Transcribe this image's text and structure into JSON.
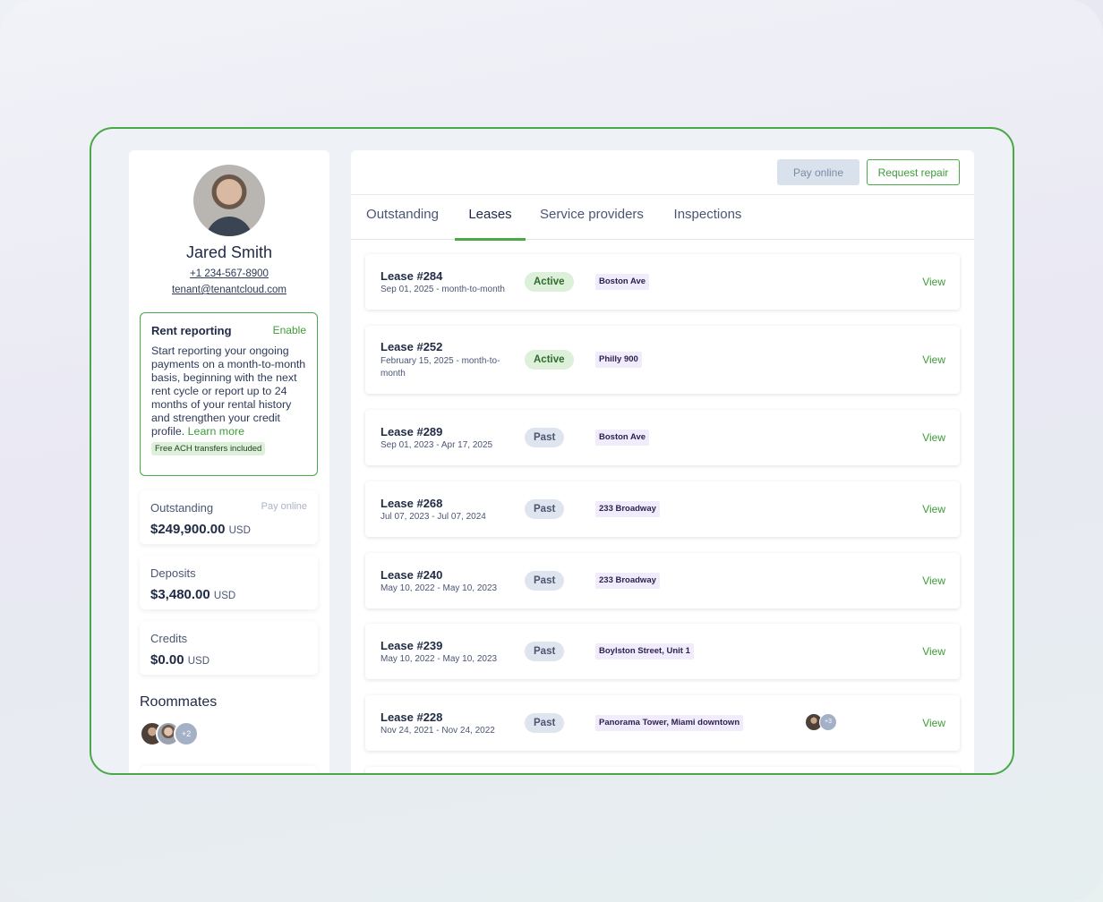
{
  "profile": {
    "name": "Jared Smith",
    "phone": "+1 234-567-8900",
    "email": "tenant@tenantcloud.com"
  },
  "rent_reporting": {
    "title": "Rent reporting",
    "action": "Enable",
    "text": "Start reporting your ongoing payments on a month-to-month basis, beginning with the next rent cycle or report up to 24 months of your rental history and strengthen your credit profile.",
    "learn_more": "Learn more",
    "badge": "Free ACH transfers included"
  },
  "stats": {
    "outstanding": {
      "label": "Outstanding",
      "value": "$249,900.00",
      "unit": "USD",
      "action": "Pay online"
    },
    "deposits": {
      "label": "Deposits",
      "value": "$3,480.00",
      "unit": "USD"
    },
    "credits": {
      "label": "Credits",
      "value": "$0.00",
      "unit": "USD"
    }
  },
  "roommates": {
    "title": "Roommates",
    "extra": "+2"
  },
  "toolbar": {
    "pay_online": "Pay online",
    "request_repair": "Request repair"
  },
  "tabs": [
    "Outstanding",
    "Leases",
    "Service providers",
    "Inspections"
  ],
  "active_tab": "Leases",
  "leases": [
    {
      "title": "Lease #284",
      "dates": "Sep 01, 2025 - month-to-month",
      "status": "Active",
      "property": "Boston Ave",
      "action": "View"
    },
    {
      "title": "Lease #252",
      "dates": "February 15, 2025 - month-to-month",
      "status": "Active",
      "property": "Philly 900",
      "action": "View"
    },
    {
      "title": "Lease #289",
      "dates": "Sep 01, 2023 - Apr 17, 2025",
      "status": "Past",
      "property": "Boston Ave",
      "action": "View"
    },
    {
      "title": "Lease #268",
      "dates": "Jul 07, 2023 - Jul 07, 2024",
      "status": "Past",
      "property": "233 Broadway",
      "action": "View"
    },
    {
      "title": "Lease #240",
      "dates": "May 10, 2022 - May 10, 2023",
      "status": "Past",
      "property": "233 Broadway",
      "action": "View"
    },
    {
      "title": "Lease #239",
      "dates": "May 10, 2022 - May 10, 2023",
      "status": "Past",
      "property": "Boylston Street, Unit 1",
      "action": "View"
    },
    {
      "title": "Lease #228",
      "dates": "Nov 24, 2021 - Nov 24, 2022",
      "status": "Past",
      "property": "Panorama Tower, Miami downtown",
      "action": "View",
      "tenants_extra": "+3"
    }
  ],
  "colors": {
    "accent": "#4aa846",
    "active_badge": "#dcf0da",
    "past_badge": "#dfe5ee",
    "property_tag": "#f1ecfb"
  }
}
